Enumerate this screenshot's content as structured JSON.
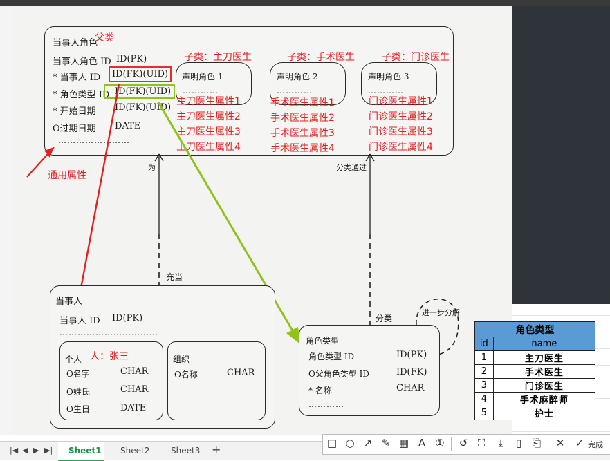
{
  "diagram": {
    "parent": {
      "title": "当事人角色",
      "annotation": "父类",
      "rows": [
        {
          "name": "当事人角色 ID",
          "type": "ID(PK)"
        },
        {
          "name": "* 当事人 ID",
          "type": "ID(FK)(UID)"
        },
        {
          "name": "* 角色类型 ID",
          "type": "ID(FK)(UID)"
        },
        {
          "name": "* 开始日期",
          "type": "ID(FK)(UID)"
        },
        {
          "name": "O过期日期",
          "type": "DATE"
        }
      ],
      "dots": "……………………",
      "generic_attr_label": "通用属性"
    },
    "subclasses": [
      {
        "label": "子类：主刀医生",
        "box": "声明角色 1",
        "dots": "…………",
        "attrs": [
          "主刀医生属性1",
          "主刀医生属性2",
          "主刀医生属性3",
          "主刀医生属性4"
        ]
      },
      {
        "label": "子类：手术医生",
        "box": "声明角色 2",
        "dots": "…………",
        "attrs": [
          "手术医生属性1",
          "手术医生属性2",
          "手术医生属性3",
          "手术医生属性4"
        ]
      },
      {
        "label": "子类：门诊医生",
        "box": "声明角色 3",
        "dots": "…………",
        "attrs": [
          "门诊医生属性1",
          "门诊医生属性2",
          "门诊医生属性3",
          "门诊医生属性4"
        ]
      }
    ],
    "rel_labels": {
      "wei": "为",
      "classified_by": "分类通过",
      "acts_as": "充当",
      "classify": "分类",
      "further": "进一步分解"
    },
    "party": {
      "title": "当事人",
      "id_name": "当事人 ID",
      "id_type": "ID(PK)",
      "dots": "……………………………",
      "person": {
        "title": "个人",
        "annotation": "人：张三",
        "rows": [
          {
            "name": "O名字",
            "type": "CHAR"
          },
          {
            "name": "O姓氏",
            "type": "CHAR"
          },
          {
            "name": "O生日",
            "type": "DATE"
          }
        ]
      },
      "org": {
        "title": "组织",
        "rows": [
          {
            "name": "O名称",
            "type": "CHAR"
          }
        ]
      }
    },
    "role_type": {
      "title": "角色类型",
      "rows": [
        {
          "name": "角色类型 ID",
          "type": "ID(PK)"
        },
        {
          "name": "O父角色类型 ID",
          "type": "ID(FK)"
        },
        {
          "name": "* 名称",
          "type": "CHAR"
        }
      ],
      "dots": "…………"
    }
  },
  "table": {
    "title": "角色类型",
    "headers": [
      "id",
      "name"
    ],
    "rows": [
      [
        "1",
        "主刀医生"
      ],
      [
        "2",
        "手术医生"
      ],
      [
        "3",
        "门诊医生"
      ],
      [
        "4",
        "手术麻醉师"
      ],
      [
        "5",
        "护士"
      ]
    ]
  },
  "sheet_tabs": [
    "Sheet1",
    "Sheet2",
    "Sheet3"
  ],
  "add_tab": "+",
  "toolbar": {
    "icons": [
      "rectangle-icon",
      "circle-icon",
      "arrow-icon",
      "pen-icon",
      "mosaic-icon",
      "text-icon",
      "number-icon",
      "undo-icon",
      "crop-icon",
      "download-icon",
      "pin-icon",
      "bookmark-icon",
      "close-icon"
    ],
    "done_label": "完成"
  },
  "colors": {
    "annotation_red": "#e02020",
    "arrow_green": "#8fc21a",
    "table_header": "#5b9bd5"
  }
}
